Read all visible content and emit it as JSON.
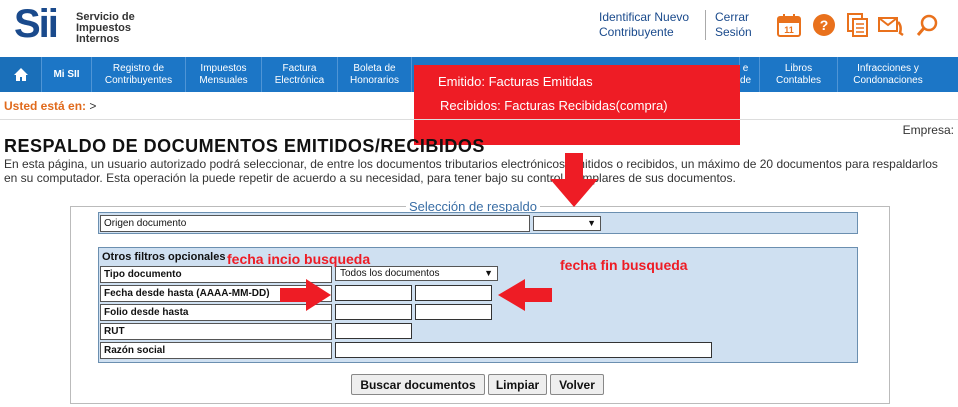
{
  "header": {
    "logo_mark": "Sii",
    "logo_lines": [
      "Servicio de",
      "Impuestos",
      "Internos"
    ],
    "identify_link": [
      "Identificar Nuevo",
      "Contribuyente"
    ],
    "logout_link": [
      "Cerrar",
      "Sesión"
    ],
    "calendar_day": "11",
    "help_glyph": "?",
    "icons": [
      "calendar-icon",
      "help-icon",
      "documents-icon",
      "contact-icon",
      "search-icon"
    ],
    "accent_orange": "#e9711c",
    "brand_blue": "#1a4a8c"
  },
  "nav": {
    "items": [
      {
        "label": ""
      },
      {
        "label": "Mi SII"
      },
      {
        "label": "Registro de\nContribuyentes"
      },
      {
        "label": "Impuestos\nMensuales"
      },
      {
        "label": "Factura\nElectrónica"
      },
      {
        "label": "Boleta de\nHonorarios"
      },
      {
        "label": "e"
      },
      {
        "label": "de"
      },
      {
        "label": "Libros\nContables"
      },
      {
        "label": "Infracciones y\nCondonaciones"
      }
    ],
    "bar_color": "#1c76c6"
  },
  "overlay": {
    "line1": "Emitido: Facturas Emitidas",
    "line2": "Recibidos: Facturas Recibidas(compra)",
    "color": "#ee1c25"
  },
  "breadcrumb": {
    "label": "Usted está en:",
    "separator": ">"
  },
  "empresa_label": "Empresa:",
  "page": {
    "title": "RESPALDO DE DOCUMENTOS EMITIDOS/RECIBIDOS",
    "description": "En esta página, un usuario autorizado podrá seleccionar, de entre los documentos tributarios electrónicos emitidos o recibidos, un máximo de 20 documentos para respaldarlos en su computador. Esta operación la puede repetir de acuerdo a su necesidad, para tener bajo su control ejemplares de sus documentos."
  },
  "form": {
    "section_title": "Selección de respaldo",
    "origen_label": "Origen documento",
    "origen_value": "",
    "filters_caption": "Otros filtros opcionales",
    "tipo_label": "Tipo documento",
    "tipo_value": "Todos los documentos",
    "fecha_label": "Fecha desde hasta (AAAA-MM-DD)",
    "folio_label": "Folio desde hasta",
    "rut_label": "RUT",
    "razon_label": "Razón social",
    "buttons": {
      "search": "Buscar documentos",
      "clear": "Limpiar",
      "back": "Volver"
    },
    "panel_color": "#cfe0f1"
  },
  "annotations": {
    "start_date": "fecha incio busqueda",
    "end_date": "fecha fin busqueda"
  }
}
